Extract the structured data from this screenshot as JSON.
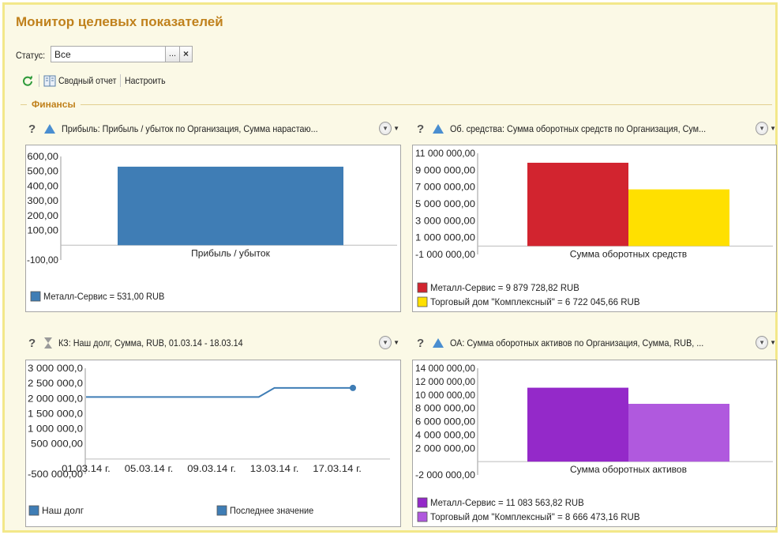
{
  "title": "Монитор целевых показателей",
  "status": {
    "label": "Статус:",
    "value": "Все",
    "choose": "...",
    "clear": "×"
  },
  "toolbar": {
    "report": "Сводный отчет",
    "settings": "Настроить"
  },
  "group": {
    "title": "Финансы"
  },
  "panels": [
    {
      "help": "?",
      "header": "Прибыль: Прибыль / убыток по Организация, Сумма нарастаю..."
    },
    {
      "help": "?",
      "header": "Об. средства: Сумма оборотных средств по Организация, Сум..."
    },
    {
      "help": "?",
      "header": "КЗ: Наш долг, Сумма, RUB, 01.03.14 - 18.03.14"
    },
    {
      "help": "?",
      "header": "ОА: Сумма оборотных активов по Организация, Сумма, RUB, ..."
    }
  ],
  "colors": {
    "accent": "#c0811c",
    "blue": "#3f7db5",
    "red": "#d2242f",
    "yellow": "#ffe000",
    "purple1": "#9429c9",
    "purple2": "#b059de"
  },
  "chart_data": [
    {
      "type": "bar",
      "categories": [
        "Прибыль / убыток"
      ],
      "series": [
        {
          "name": "Металл-Сервис = 531,00 RUB",
          "values": [
            531
          ],
          "color": "#3f7db5"
        }
      ],
      "yticks": [
        "600,00",
        "500,00",
        "400,00",
        "300,00",
        "200,00",
        "100,00",
        "-100,00"
      ],
      "ylim": [
        -100,
        600
      ],
      "legend": "bottom-left"
    },
    {
      "type": "bar",
      "categories": [
        "Сумма оборотных средств"
      ],
      "series": [
        {
          "name": "Металл-Сервис = 9 879 728,82 RUB",
          "values": [
            9879728.82
          ],
          "color": "#d2242f"
        },
        {
          "name": "Торговый дом \"Комплексный\" = 6 722 045,66 RUB",
          "values": [
            6722045.66
          ],
          "color": "#ffe000"
        }
      ],
      "yticks": [
        "11 000 000,00",
        "9 000 000,00",
        "7 000 000,00",
        "5 000 000,00",
        "3 000 000,00",
        "1 000 000,00",
        "-1 000 000,00"
      ],
      "ylim": [
        -1000000,
        11000000
      ],
      "legend": "bottom-left"
    },
    {
      "type": "line",
      "x": [
        "01.03.14",
        "02.03.14",
        "03.03.14",
        "04.03.14",
        "05.03.14",
        "06.03.14",
        "07.03.14",
        "08.03.14",
        "09.03.14",
        "10.03.14",
        "11.03.14",
        "12.03.14",
        "13.03.14",
        "14.03.14",
        "15.03.14",
        "16.03.14",
        "17.03.14",
        "18.03.14"
      ],
      "xticks": [
        "01.03.14 г.",
        "05.03.14 г.",
        "09.03.14 г.",
        "13.03.14 г.",
        "17.03.14 г."
      ],
      "series": [
        {
          "name": "Наш долг",
          "values": [
            2050000,
            2050000,
            2050000,
            2050000,
            2050000,
            2050000,
            2050000,
            2050000,
            2050000,
            2050000,
            2050000,
            2050000,
            2350000,
            2350000,
            2350000,
            2350000,
            2350000,
            2350000
          ],
          "color": "#3f7db5"
        }
      ],
      "last_marker": "Последнее значение",
      "yticks": [
        "3 000 000,0",
        "2 500 000,0",
        "2 000 000,0",
        "1 500 000,0",
        "1 000 000,0",
        "500 000,00",
        "-500 000,00"
      ],
      "ylim": [
        -500000,
        3000000
      ],
      "legend": "bottom"
    },
    {
      "type": "bar",
      "categories": [
        "Сумма оборотных активов"
      ],
      "series": [
        {
          "name": "Металл-Сервис = 11 083 563,82 RUB",
          "values": [
            11083563.82
          ],
          "color": "#9429c9"
        },
        {
          "name": "Торговый дом \"Комплексный\" = 8 666 473,16 RUB",
          "values": [
            8666473.16
          ],
          "color": "#b059de"
        }
      ],
      "yticks": [
        "14 000 000,00",
        "12 000 000,00",
        "10 000 000,00",
        "8 000 000,00",
        "6 000 000,00",
        "4 000 000,00",
        "2 000 000,00",
        "-2 000 000,00"
      ],
      "ylim": [
        -2000000,
        14000000
      ],
      "legend": "bottom-left"
    }
  ]
}
